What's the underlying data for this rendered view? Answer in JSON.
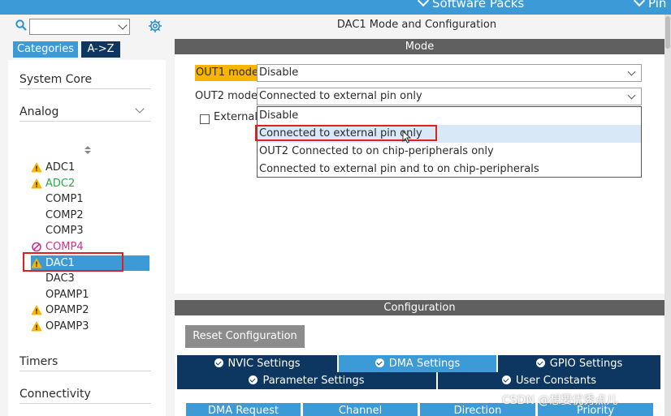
{
  "topbar": {
    "software_packs": "Software Packs",
    "pinout": "Pin"
  },
  "left": {
    "search": {
      "value": "",
      "placeholder": ""
    },
    "tabs": {
      "categories": "Categories",
      "az": "A->Z"
    },
    "sections": {
      "system_core": "System Core",
      "analog": "Analog",
      "timers": "Timers",
      "connectivity": "Connectivity"
    },
    "analog_items": [
      {
        "label": "ADC1",
        "status": "warning",
        "color": "#2b2b2b"
      },
      {
        "label": "ADC2",
        "status": "warning",
        "color": "#29a84a"
      },
      {
        "label": "COMP1",
        "status": "none",
        "color": "#2b2b2b"
      },
      {
        "label": "COMP2",
        "status": "none",
        "color": "#2b2b2b"
      },
      {
        "label": "COMP3",
        "status": "none",
        "color": "#2b2b2b"
      },
      {
        "label": "COMP4",
        "status": "disabled",
        "color": "#d0308a"
      },
      {
        "label": "DAC1",
        "status": "warning",
        "color": "#ffffff",
        "selected": true
      },
      {
        "label": "DAC3",
        "status": "none",
        "color": "#2b2b2b"
      },
      {
        "label": "OPAMP1",
        "status": "none",
        "color": "#2b2b2b"
      },
      {
        "label": "OPAMP2",
        "status": "warning",
        "color": "#2b2b2b"
      },
      {
        "label": "OPAMP3",
        "status": "warning",
        "color": "#2b2b2b"
      }
    ]
  },
  "right": {
    "title": "DAC1 Mode and Configuration",
    "mode_header": "Mode",
    "out1": {
      "label": "OUT1 mode",
      "value": "Disable"
    },
    "out2": {
      "label": "OUT2 mode",
      "value": "Connected to external pin only"
    },
    "external_checkbox": "External",
    "dropdown_options": [
      "Disable",
      "Connected to external pin only",
      "OUT2 Connected to on chip-peripherals only",
      "Connected to external pin and to on chip-peripherals"
    ],
    "config_header": "Configuration",
    "reset_button": "Reset Configuration",
    "config_tabs": {
      "nvic": "NVIC Settings",
      "dma": "DMA Settings",
      "gpio": "GPIO Settings",
      "parameter": "Parameter Settings",
      "user_constants": "User Constants"
    },
    "dma_columns": [
      "DMA Request",
      "Channel",
      "Direction",
      "Priority"
    ]
  },
  "watermark": "CSDN @想要优秀点儿",
  "colors": {
    "accent": "#3c9bd6",
    "dark_tab": "#0d3660",
    "warning": "#f7b500",
    "highlight": "#e02020"
  }
}
